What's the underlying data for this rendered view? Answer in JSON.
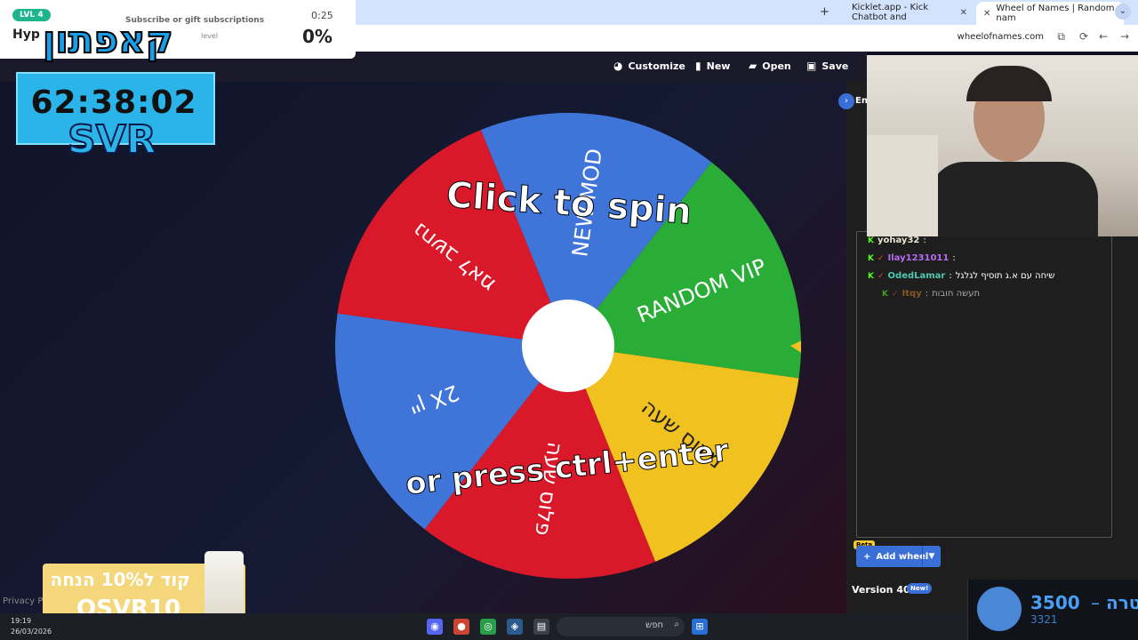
{
  "browser": {
    "tabs": [
      {
        "title": "Kicklet.app - Kick Chatbot and",
        "active": false
      },
      {
        "title": "Wheel of Names | Random nam",
        "active": true
      }
    ],
    "new_tab_icon": "plus-icon",
    "url": "wheelofnames.com"
  },
  "toolbar": {
    "customize": "Customize",
    "new": "New",
    "open": "Open",
    "save": "Save"
  },
  "wheel": {
    "center_prompt": "Click to spin",
    "center_prompt2": "or press ctrl+enter",
    "segments": [
      {
        "label": "NEW MOD",
        "color": "#3f74d9"
      },
      {
        "label": "RANDOM VIP",
        "color": "#2aad36"
      },
      {
        "label": "מינוס שעה",
        "color": "#f0c11f"
      },
      {
        "label": "פלוס שעה",
        "color": "#d9182a"
      },
      {
        "label": "2X יין",
        "color": "#3f74d9"
      },
      {
        "label": "נחשב לאמ",
        "color": "#d9182a"
      }
    ]
  },
  "sidebar": {
    "entries_tab": "En",
    "add_wheel": "Add wheel",
    "beta": "Beta",
    "version": "Version 405",
    "new_badge": "New!"
  },
  "chat": [
    {
      "user": "yohay32",
      "msg": "",
      "color": "#e8e3cf"
    },
    {
      "user": "Ilay1231011",
      "msg": "",
      "color": "#b66cf0"
    },
    {
      "user": "OdedLamar",
      "msg": "שיחה עם א.ג תוסיף לגלגל",
      "color": "#4ec9b0"
    },
    {
      "user": "Itqy",
      "msg": "תעשה חובות",
      "color": "#d07a2a"
    }
  ],
  "overlay": {
    "level": "LVL 4",
    "hype_partial": "Hyp",
    "sub_text": "Subscribe or gift subscriptions",
    "sub_text2": "level",
    "sub_timer": "0:25",
    "sub_percent": "0%",
    "logo_text": "קאפתון",
    "countdown": "62:38:02",
    "brand": "SVR",
    "promo_line1": "קוד ל10% הנחה",
    "promo_line2": "OSVR10",
    "privacy": "Privacy P"
  },
  "goal": {
    "value": "3500",
    "dash": "–",
    "label": "מטרה",
    "current": "3321"
  },
  "taskbar": {
    "time": "19:19",
    "date": "26/03/2026",
    "search_placeholder": "חפש"
  }
}
